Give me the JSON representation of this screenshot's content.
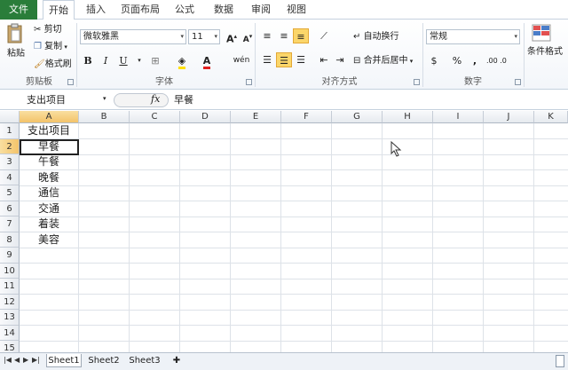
{
  "tabs": [
    "文件",
    "开始",
    "插入",
    "页面布局",
    "公式",
    "数据",
    "审阅",
    "视图"
  ],
  "clipboard": {
    "paste": "粘贴",
    "cut": "剪切",
    "copy": "复制",
    "format_painter": "格式刷",
    "group": "剪贴板"
  },
  "font": {
    "name": "微软雅黑",
    "size": "11",
    "bold": "B",
    "italic": "I",
    "underline": "U",
    "group": "字体",
    "grow": "A",
    "shrink": "A",
    "pinyin": "wén"
  },
  "alignment": {
    "wrap": "自动换行",
    "merge": "合并后居中",
    "group": "对齐方式"
  },
  "number": {
    "format": "常规",
    "percent": "%",
    "comma": ",",
    "inc_dec": ".00 .0",
    "group": "数字"
  },
  "styles": {
    "conditional": "条件格式"
  },
  "formula_bar": {
    "name_box": "支出项目",
    "fx": "fx",
    "value": "早餐"
  },
  "columns": [
    "A",
    "B",
    "C",
    "D",
    "E",
    "F",
    "G",
    "H",
    "I",
    "J",
    "K"
  ],
  "rows": [
    "1",
    "2",
    "3",
    "4",
    "5",
    "6",
    "7",
    "8",
    "9",
    "10",
    "11",
    "12",
    "13",
    "14",
    "15"
  ],
  "cells_A": [
    "支出项目",
    "早餐",
    "午餐",
    "晚餐",
    "通信",
    "交通",
    "着装",
    "美容"
  ],
  "sheets": [
    "Sheet1",
    "Sheet2",
    "Sheet3"
  ],
  "colors": {
    "file_tab": "#2a7d3a",
    "highlight": "#fbd66a",
    "font_red": "#e02020"
  }
}
